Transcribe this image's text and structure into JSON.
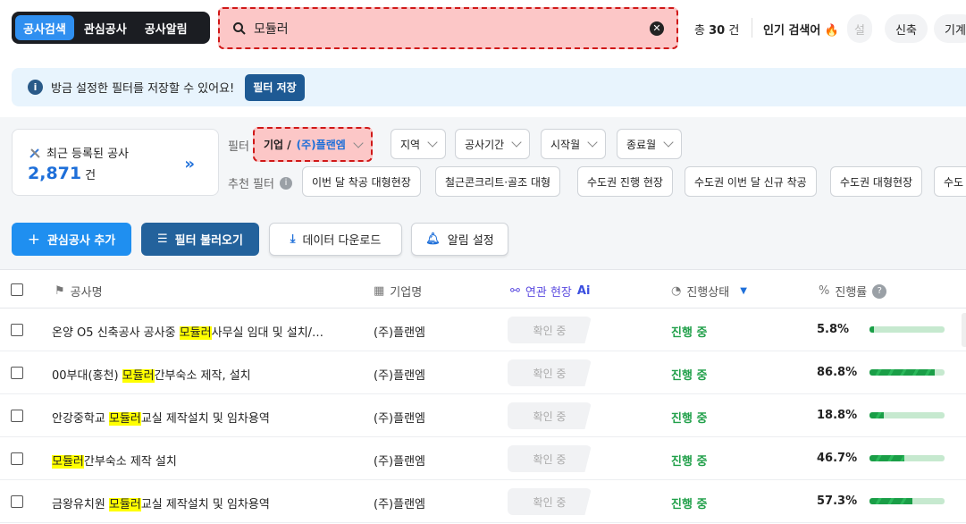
{
  "nav": {
    "tabs": [
      {
        "label": "공사검색"
      },
      {
        "label": "관심공사"
      },
      {
        "label": "공사알림"
      }
    ]
  },
  "search": {
    "value": "모듈러",
    "placeholder": ""
  },
  "result": {
    "prefix": "총 ",
    "count": "30",
    "suffix": " 건"
  },
  "popular": {
    "label": "인기 검색어",
    "chips": [
      "설",
      "신축",
      "기계"
    ]
  },
  "banner": {
    "text": "방금 설정한 필터를 저장할 수 있어요!",
    "button": "필터 저장"
  },
  "recent": {
    "label": "최근 등록된 공사",
    "count": "2,871",
    "unit": "건"
  },
  "filters": {
    "label": "필터",
    "company": {
      "prefix": "기업 / ",
      "value": "(주)플랜엠"
    },
    "items": [
      "지역",
      "공사기간",
      "시작월",
      "종료월"
    ]
  },
  "recommend": {
    "label": "추천 필터",
    "items": [
      "이번 달 착공 대형현장",
      "철근콘크리트·골조 대형",
      "수도권 진행 현장",
      "수도권 이번 달 신규 착공",
      "수도권 대형현장",
      "수도"
    ]
  },
  "actions": {
    "add": "관심공사 추가",
    "load": "필터 불러오기",
    "download": "데이터 다운로드",
    "alert": "알림 설정"
  },
  "table": {
    "headers": {
      "name": "공사명",
      "company": "기업명",
      "related": "연관 현장",
      "related_badge": "Ai",
      "status": "진행상태",
      "progress": "진행률"
    },
    "rows": [
      {
        "pre": "온양 O5 신축공사 공사중 ",
        "hl": "모듈러",
        "post": "사무실 임대 및 설치/…",
        "company": "(주)플랜엠",
        "related": "확인 중",
        "status": "진행 중",
        "pct_label": "5.8%",
        "pct": 5.8
      },
      {
        "pre": "00부대(홍천) ",
        "hl": "모듈러",
        "post": "간부숙소 제작, 설치",
        "company": "(주)플랜엠",
        "related": "확인 중",
        "status": "진행 중",
        "pct_label": "86.8%",
        "pct": 86.8
      },
      {
        "pre": "안강중학교 ",
        "hl": "모듈러",
        "post": "교실 제작설치 및 임차용역",
        "company": "(주)플랜엠",
        "related": "확인 중",
        "status": "진행 중",
        "pct_label": "18.8%",
        "pct": 18.8
      },
      {
        "pre": "",
        "hl": "모듈러",
        "post": "간부숙소 제작 설치",
        "company": "(주)플랜엠",
        "related": "확인 중",
        "status": "진행 중",
        "pct_label": "46.7%",
        "pct": 46.7
      },
      {
        "pre": "금왕유치원 ",
        "hl": "모듈러",
        "post": "교실 제작설치 및 임차용역",
        "company": "(주)플랜엠",
        "related": "확인 중",
        "status": "진행 중",
        "pct_label": "57.3%",
        "pct": 57.3
      }
    ]
  }
}
